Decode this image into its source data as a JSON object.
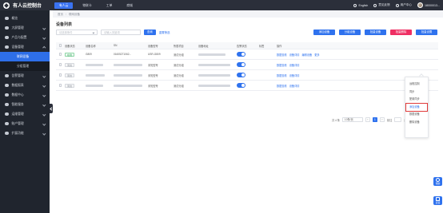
{
  "app": {
    "title": "有人云控制台"
  },
  "topnav": [
    {
      "label": "有人云",
      "active": true
    },
    {
      "label": "物联卡",
      "active": false
    },
    {
      "label": "工单",
      "active": false
    },
    {
      "label": "商城",
      "active": false
    }
  ],
  "topright": {
    "language": "English",
    "help": "意见反馈",
    "user_center": "用户中心",
    "phone": "18000013..."
  },
  "sidebar": {
    "items": [
      {
        "label": "概览"
      },
      {
        "label": "大屏管理"
      },
      {
        "label": "产品与配置"
      },
      {
        "label": "设备管理",
        "open": true
      },
      {
        "label": "告警管理"
      },
      {
        "label": "数据报表"
      },
      {
        "label": "数据中心"
      },
      {
        "label": "智能服务"
      },
      {
        "label": "运维管理"
      },
      {
        "label": "账户管理"
      },
      {
        "label": "扩展功能"
      }
    ],
    "sub_items": [
      {
        "label": "联网设备",
        "active": true
      },
      {
        "label": "分组管理",
        "active": false
      }
    ]
  },
  "breadcrumb": [
    "首页",
    "联网设备"
  ],
  "page_title": "设备列表",
  "filters": {
    "select_placeholder": "请选择条件",
    "input_placeholder": "请输入关键词",
    "search_label": "查询",
    "reset_label": "重置筛选"
  },
  "actions": [
    {
      "label": "添加设备",
      "color": "#2f72ee"
    },
    {
      "label": "分组设备",
      "color": "#2f72ee"
    },
    {
      "label": "批量设备",
      "color": "#2f72ee"
    },
    {
      "label": "批量删除",
      "color": "#ef2f63"
    },
    {
      "label": "批量设置",
      "color": "#2f72ee"
    }
  ],
  "table": {
    "columns": [
      "设备状态",
      "设备名称",
      "SN",
      "设备型号",
      "所属项目",
      "设备地址",
      "告警状态",
      "标签",
      "操作"
    ],
    "rows": [
      {
        "status": "在线",
        "online": true,
        "name": "G809",
        "sn": "01605271062...",
        "model": "USR-G809",
        "project": "测试分组",
        "ops": [
          "数据查看",
          "设备详情",
          "编辑设备",
          "更多"
        ]
      },
      {
        "status": "离线",
        "online": false,
        "name": "",
        "sn": "",
        "model": "未知型号",
        "project": "测试分组",
        "ops": [
          "数据查看",
          "设备详情"
        ]
      },
      {
        "status": "离线",
        "online": false,
        "name": "",
        "sn": "",
        "model": "未知型号",
        "project": "测试分组",
        "ops": [
          "数据查看",
          "设备详情"
        ]
      },
      {
        "status": "离线",
        "online": false,
        "name": "",
        "sn": "",
        "model": "未知型号",
        "project": "测试分组",
        "ops": [
          "数据查看",
          "设备详情"
        ]
      }
    ]
  },
  "more_menu": {
    "items": [
      {
        "label": "远程控制",
        "highlighted": false
      },
      {
        "label": "同步",
        "highlighted": false
      },
      {
        "label": "配置同步",
        "highlighted": false
      },
      {
        "label": "添加设备",
        "highlighted": true
      },
      {
        "label": "数据设备",
        "highlighted": false
      },
      {
        "label": "删除设备",
        "highlighted": false
      }
    ]
  },
  "pagination": {
    "total": "共 4 条",
    "page_size": "10条/页",
    "current": "1",
    "goto_label": "前往",
    "page_suffix": "页"
  },
  "floats": [
    {
      "label": "帮助"
    },
    {
      "label": "反馈"
    }
  ]
}
